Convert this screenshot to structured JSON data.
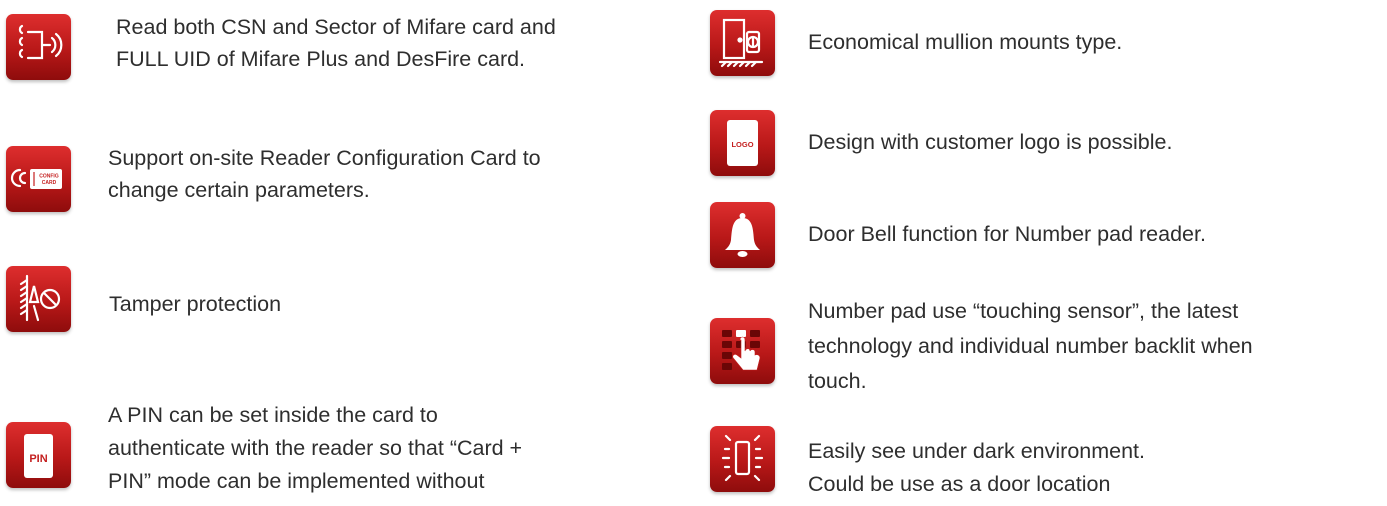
{
  "left_features": [
    {
      "icon": "wireless-read-icon",
      "lines": [
        "Read both CSN and Sector of Mifare card and",
        "FULL UID of Mifare Plus and DesFire card."
      ]
    },
    {
      "icon": "config-card-icon",
      "icon_text": "CONFIG CARD",
      "lines": [
        "Support on-site Reader Configuration Card to",
        "change certain parameters."
      ]
    },
    {
      "icon": "tamper-icon",
      "lines": [
        "Tamper protection"
      ]
    },
    {
      "icon": "pin-card-icon",
      "icon_text": "PIN",
      "lines": [
        "A PIN can be set inside the card to",
        "authenticate with the reader so that “Card +",
        "PIN” mode can be implemented without"
      ]
    }
  ],
  "right_features": [
    {
      "icon": "mullion-mount-icon",
      "lines": [
        "Economical mullion mounts type."
      ]
    },
    {
      "icon": "logo-reader-icon",
      "icon_text": "LOGO",
      "lines": [
        "Design with customer logo is possible."
      ]
    },
    {
      "icon": "bell-icon",
      "lines": [
        "Door Bell function for Number pad reader."
      ]
    },
    {
      "icon": "touch-keypad-icon",
      "lines": [
        "Number pad use “touching sensor”, the latest",
        "technology and individual number backlit when",
        "touch."
      ]
    },
    {
      "icon": "backlight-icon",
      "lines": [
        "Easily see under dark environment.",
        "Could be use as a door location"
      ]
    }
  ],
  "colors": {
    "icon_red": "#c41f1f",
    "text": "#2e2e2e"
  }
}
